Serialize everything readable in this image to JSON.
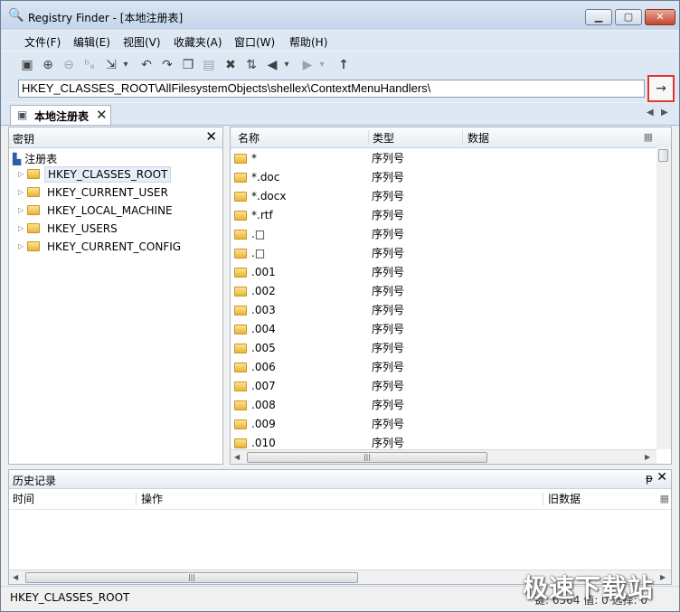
{
  "window": {
    "title": "Registry Finder - [本地注册表]"
  },
  "menu": [
    "文件(F)",
    "编辑(E)",
    "视图(V)",
    "收藏夹(A)",
    "窗口(W)",
    "帮助(H)"
  ],
  "toolbar": {
    "dropdown_glyph": "▾"
  },
  "address": {
    "value": "HKEY_CLASSES_ROOT\\AllFilesystemObjects\\shellex\\ContextMenuHandlers\\",
    "go_glyph": "→"
  },
  "tab": {
    "label": "本地注册表"
  },
  "keys_pane": {
    "title": "密钥",
    "root": "注册表",
    "items": [
      "HKEY_CLASSES_ROOT",
      "HKEY_CURRENT_USER",
      "HKEY_LOCAL_MACHINE",
      "HKEY_USERS",
      "HKEY_CURRENT_CONFIG"
    ]
  },
  "list": {
    "columns": {
      "name": "名称",
      "type": "类型",
      "data": "数据"
    },
    "rows": [
      {
        "name": "*",
        "type": "序列号"
      },
      {
        "name": "*.doc",
        "type": "序列号"
      },
      {
        "name": "*.docx",
        "type": "序列号"
      },
      {
        "name": "*.rtf",
        "type": "序列号"
      },
      {
        "name": ".□",
        "type": "序列号"
      },
      {
        "name": ".□",
        "type": "序列号"
      },
      {
        "name": ".001",
        "type": "序列号"
      },
      {
        "name": ".002",
        "type": "序列号"
      },
      {
        "name": ".003",
        "type": "序列号"
      },
      {
        "name": ".004",
        "type": "序列号"
      },
      {
        "name": ".005",
        "type": "序列号"
      },
      {
        "name": ".006",
        "type": "序列号"
      },
      {
        "name": ".007",
        "type": "序列号"
      },
      {
        "name": ".008",
        "type": "序列号"
      },
      {
        "name": ".009",
        "type": "序列号"
      },
      {
        "name": ".010",
        "type": "序列号"
      }
    ]
  },
  "history": {
    "title": "历史记录",
    "pin_glyph": "ᵽ",
    "columns": {
      "time": "时间",
      "action": "操作",
      "old_data": "旧数据"
    }
  },
  "status": {
    "path": "HKEY_CLASSES_ROOT",
    "counts": "键: 6564  值: 0  选择: 0"
  },
  "watermark": "极速下载站"
}
